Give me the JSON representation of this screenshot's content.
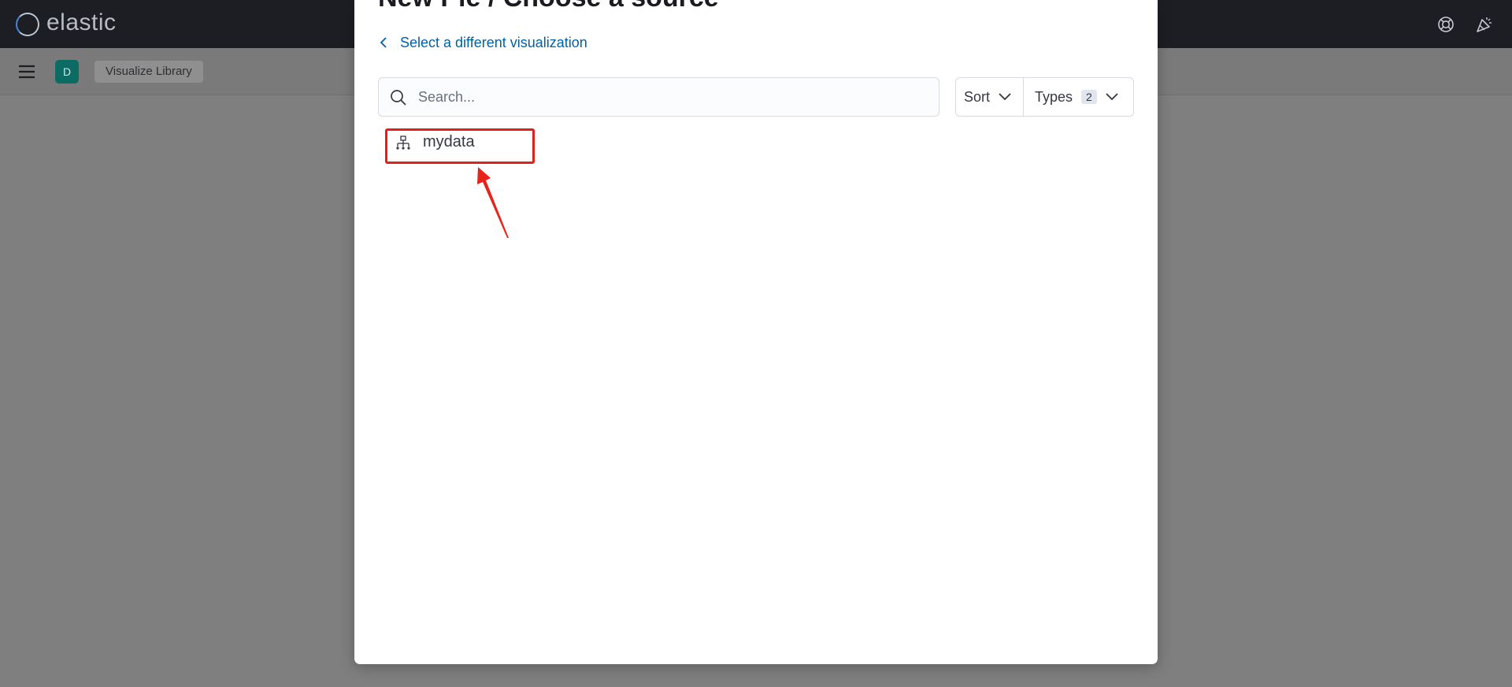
{
  "header": {
    "logo_text": "elastic",
    "icons": [
      "help-icon",
      "newsfeed-icon"
    ]
  },
  "subheader": {
    "menu_icon": "hamburger-icon",
    "space_initial": "D",
    "breadcrumb": "Visualize Library"
  },
  "modal": {
    "title": "New Pie / Choose a source",
    "back_link": "Select a different visualization",
    "search": {
      "placeholder": "Search...",
      "value": ""
    },
    "filters": {
      "sort_label": "Sort",
      "types_label": "Types",
      "types_count": "2"
    },
    "results": [
      {
        "label": "mydata",
        "icon": "index-pattern-icon"
      }
    ]
  },
  "annotation": {
    "highlight_color": "#e0201a"
  }
}
